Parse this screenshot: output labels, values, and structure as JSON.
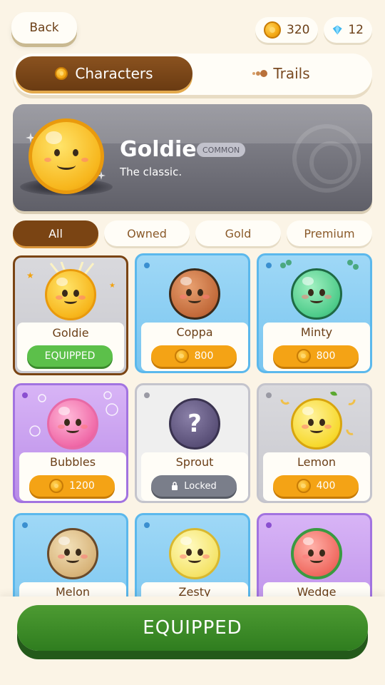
{
  "header": {
    "back_label": "Back",
    "coins": "320",
    "gems": "12"
  },
  "tabs": [
    {
      "label": "Characters"
    },
    {
      "label": "Trails"
    }
  ],
  "hero": {
    "name": "Goldie",
    "rarity": "COMMON",
    "tagline": "The classic."
  },
  "filters": [
    {
      "label": "All"
    },
    {
      "label": "Owned"
    },
    {
      "label": "Gold"
    },
    {
      "label": "Premium"
    }
  ],
  "cards": [
    {
      "name": "Goldie",
      "status": "EQUIPPED"
    },
    {
      "name": "Coppa",
      "price": "800"
    },
    {
      "name": "Minty",
      "price": "800"
    },
    {
      "name": "Bubbles",
      "price": "1200"
    },
    {
      "name": "Sprout",
      "status": "Locked"
    },
    {
      "name": "Lemon",
      "price": "400"
    },
    {
      "name": "Melon"
    },
    {
      "name": "Zesty"
    },
    {
      "name": "Wedge"
    }
  ],
  "main_action": {
    "label": "EQUIPPED"
  },
  "colors": {
    "gold": "#f4a915",
    "equipped_green": "#3f9a2c",
    "blue_card": "#78c8f2",
    "purple_card": "#b98ce8",
    "gray_card": "#c4c4cc"
  }
}
